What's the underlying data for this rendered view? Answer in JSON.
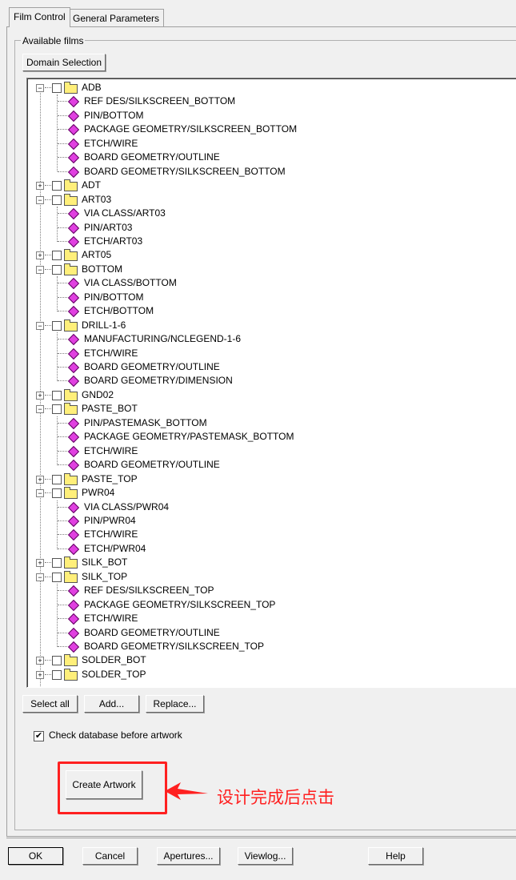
{
  "tabs": [
    {
      "label": "Film Control",
      "active": true
    },
    {
      "label": "General Parameters",
      "active": false
    }
  ],
  "group_label": "Available films",
  "domain_button": "Domain Selection",
  "tree": [
    {
      "name": "ADB",
      "expanded": true,
      "children": [
        "REF DES/SILKSCREEN_BOTTOM",
        "PIN/BOTTOM",
        "PACKAGE GEOMETRY/SILKSCREEN_BOTTOM",
        "ETCH/WIRE",
        "BOARD GEOMETRY/OUTLINE",
        "BOARD GEOMETRY/SILKSCREEN_BOTTOM"
      ]
    },
    {
      "name": "ADT",
      "expanded": false,
      "children": []
    },
    {
      "name": "ART03",
      "expanded": true,
      "children": [
        "VIA CLASS/ART03",
        "PIN/ART03",
        "ETCH/ART03"
      ]
    },
    {
      "name": "ART05",
      "expanded": false,
      "children": []
    },
    {
      "name": "BOTTOM",
      "expanded": true,
      "children": [
        "VIA CLASS/BOTTOM",
        "PIN/BOTTOM",
        "ETCH/BOTTOM"
      ]
    },
    {
      "name": "DRILL-1-6",
      "expanded": true,
      "children": [
        "MANUFACTURING/NCLEGEND-1-6",
        "ETCH/WIRE",
        "BOARD GEOMETRY/OUTLINE",
        "BOARD GEOMETRY/DIMENSION"
      ]
    },
    {
      "name": "GND02",
      "expanded": false,
      "children": []
    },
    {
      "name": "PASTE_BOT",
      "expanded": true,
      "children": [
        "PIN/PASTEMASK_BOTTOM",
        "PACKAGE GEOMETRY/PASTEMASK_BOTTOM",
        "ETCH/WIRE",
        "BOARD GEOMETRY/OUTLINE"
      ]
    },
    {
      "name": "PASTE_TOP",
      "expanded": false,
      "children": []
    },
    {
      "name": "PWR04",
      "expanded": true,
      "children": [
        "VIA CLASS/PWR04",
        "PIN/PWR04",
        "ETCH/WIRE",
        "ETCH/PWR04"
      ]
    },
    {
      "name": "SILK_BOT",
      "expanded": false,
      "children": []
    },
    {
      "name": "SILK_TOP",
      "expanded": true,
      "children": [
        "REF DES/SILKSCREEN_TOP",
        "PACKAGE GEOMETRY/SILKSCREEN_TOP",
        "ETCH/WIRE",
        "BOARD GEOMETRY/OUTLINE",
        "BOARD GEOMETRY/SILKSCREEN_TOP"
      ]
    },
    {
      "name": "SOLDER_BOT",
      "expanded": false,
      "children": []
    },
    {
      "name": "SOLDER_TOP",
      "expanded": false,
      "children": []
    }
  ],
  "buttons": {
    "select_all": "Select all",
    "add": "Add...",
    "replace": "Replace...",
    "create_artwork": "Create Artwork",
    "ok": "OK",
    "cancel": "Cancel",
    "apertures": "Apertures...",
    "viewlog": "Viewlog...",
    "help": "Help"
  },
  "check_database": {
    "label": "Check database before artwork",
    "checked": true
  },
  "annotation": {
    "text": "设计完成后点击",
    "color": "#ff2020"
  }
}
